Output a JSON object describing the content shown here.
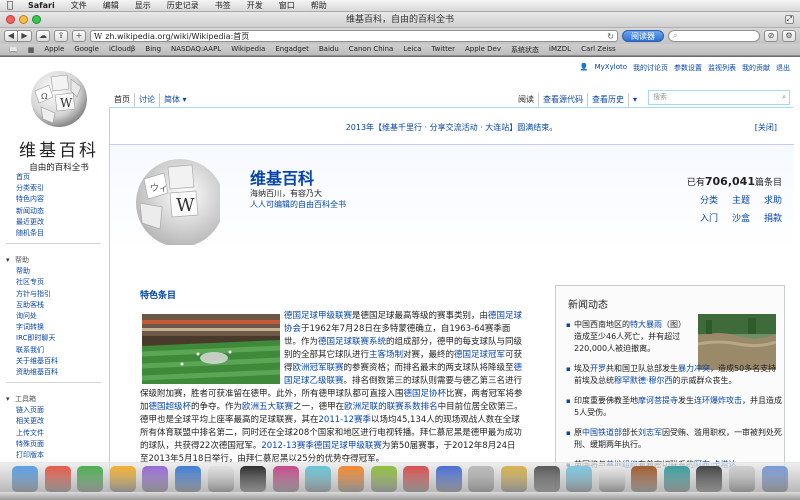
{
  "menubar": {
    "apple_icon": "",
    "items": [
      "Safari",
      "文件",
      "编辑",
      "显示",
      "历史记录",
      "书签",
      "开发",
      "窗口",
      "帮助"
    ]
  },
  "window": {
    "title": "维基百科，自由的百科全书"
  },
  "toolbar": {
    "back": "◀",
    "forward": "▶",
    "cloud": "☁",
    "share": "⇪",
    "add": "+",
    "url": "zh.wikipedia.org/wiki/Wikipedia:首页",
    "reload": "↻",
    "reader_label": "阅读器",
    "search_placeholder": "",
    "stop": "⊘",
    "extension": "⚙"
  },
  "bookmarks": [
    "Apple",
    "Google",
    "iCloudβ",
    "Bing",
    "NASDAQ:AAPL",
    "Wikipedia",
    "Engadget",
    "Baidu",
    "Canon China",
    "Leica",
    "Twitter",
    "Apple Dev",
    "系统状态",
    "iMZDL",
    "Carl Zeiss"
  ],
  "personal_tools": [
    "MyXyloto",
    "我的讨论页",
    "参数设置",
    "监视列表",
    "我的贡献",
    "退出"
  ],
  "logo": {
    "title": "维基百科",
    "subtitle": "自由的百科全书"
  },
  "tabs_left": [
    "首页",
    "讨论",
    "简体 ▾"
  ],
  "tabs_right": [
    "阅读",
    "查看源代码",
    "查看历史",
    "▾"
  ],
  "search_placeholder": "搜索",
  "notice": {
    "text": "2013年【维基千里行 · 分享交流活动 · 大连站】圆满结束。",
    "close": "[关闭]"
  },
  "banner": {
    "title": "维基百科",
    "tagline1": "海纳百川，有容乃大",
    "tagline2": "人人可编辑的自由百科全书",
    "count_prefix": "已有",
    "count": "706,041",
    "count_suffix": "篇条目",
    "portals": [
      "分类",
      "主题",
      "求助",
      "入门",
      "沙盒",
      "捐款"
    ]
  },
  "featured": {
    "heading": "特色条目",
    "text_html": [
      {
        "t": "德国足球甲级联赛",
        "l": true
      },
      {
        "t": "是德国足球最高等级的赛事类别，由",
        "l": false
      },
      {
        "t": "德国足球协会",
        "l": true
      },
      {
        "t": "于1962年7月28日在多特蒙德确立，自1963-64赛季面世。作为",
        "l": false
      },
      {
        "t": "德国足球联赛系统",
        "l": true
      },
      {
        "t": "的组成部分，德甲的每支球队与同级别的全部其它球队进行",
        "l": false
      },
      {
        "t": "主客场制",
        "l": true
      },
      {
        "t": "对赛，最终的",
        "l": false
      },
      {
        "t": "德国足球冠军",
        "l": true
      },
      {
        "t": "可获得",
        "l": false
      },
      {
        "t": "欧洲冠军联赛",
        "l": true
      },
      {
        "t": "的参赛资格；而排名最末的两支球队将降级至",
        "l": false
      },
      {
        "t": "德国足球乙级联赛",
        "l": true
      },
      {
        "t": "。排名倒数第三的球队则需要与德乙第三名进行保级附加赛，胜者可获准留在德甲。此外，所有德甲球队都可直接入围",
        "l": false
      },
      {
        "t": "德国足协杯",
        "l": true
      },
      {
        "t": "比赛，两者冠军将参加",
        "l": false
      },
      {
        "t": "德国超级杯",
        "l": true
      },
      {
        "t": "的争夺。作为",
        "l": false
      },
      {
        "t": "欧洲五大联赛",
        "l": true
      },
      {
        "t": "之一，德甲在",
        "l": false
      },
      {
        "t": "欧洲足联的联赛系数排名",
        "l": true
      },
      {
        "t": "中目前位居全欧第三。德甲也是全球平均上座率最高的足球联赛，其在",
        "l": false
      },
      {
        "t": "2011-12赛季",
        "l": true
      },
      {
        "t": "以场均45,134人的现场观战人数在全球所有体育联盟中排名第二，同时还在全球208个国家和地区进行电视转播。拜仁慕尼黑是德甲最为成功的球队，共获得22次德国冠军。",
        "l": false
      },
      {
        "t": "2012-13赛季德国足球甲级联赛",
        "l": true
      },
      {
        "t": "为第50届赛事，于2012年8月24日至2013年5月18日举行，由拜仁慕尼黑以25分的优势夺得冠军。",
        "l": false
      }
    ]
  },
  "news": {
    "heading": "新闻动态",
    "items": [
      [
        {
          "t": "中国西南地区的",
          "l": false
        },
        {
          "t": "特大暴雨",
          "l": true
        },
        {
          "t": "（图）造成至少46人死亡，并有超过220,000人被迫撤离。",
          "l": false
        }
      ],
      [
        {
          "t": "埃及",
          "l": false
        },
        {
          "t": "开罗",
          "l": true
        },
        {
          "t": "共和国卫队总部发生",
          "l": false
        },
        {
          "t": "暴力冲突",
          "l": true
        },
        {
          "t": "，造成50多名支持前埃及总统",
          "l": false
        },
        {
          "t": "穆罕默德·穆尔西",
          "l": true
        },
        {
          "t": "的示威群众丧生。",
          "l": false
        }
      ],
      [
        {
          "t": "印度重要佛教圣地",
          "l": false
        },
        {
          "t": "摩诃菩提寺",
          "l": true
        },
        {
          "t": "发生",
          "l": false
        },
        {
          "t": "连环爆炸攻击",
          "l": true
        },
        {
          "t": "，并且造成5人受伤。",
          "l": false
        }
      ],
      [
        {
          "t": "原",
          "l": false
        },
        {
          "t": "中国铁道部",
          "l": true
        },
        {
          "t": "部长",
          "l": false
        },
        {
          "t": "刘志军",
          "l": true
        },
        {
          "t": "因受贿、滥用职权，一审被判处死刑、缓期两年执行。",
          "l": false
        }
      ],
      [
        {
          "t": "英国将与",
          "l": false
        },
        {
          "t": "基地组织",
          "l": true
        },
        {
          "t": "有着密切联系的",
          "l": false
        },
        {
          "t": "阿布·卡塔达",
          "l": true
        }
      ]
    ]
  },
  "sidebar": {
    "main": [
      "首页",
      "分类索引",
      "特色内容",
      "新闻动态",
      "最近更改",
      "随机条目"
    ],
    "help_heading": "帮助",
    "help": [
      "帮助",
      "社区专页",
      "方针与指引",
      "互助客栈",
      "询问处",
      "字词转换",
      "IRC即时聊天",
      "联系我们",
      "关于维基百科",
      "资助维基百科"
    ],
    "tools_heading": "工具箱",
    "tools": [
      "链入页面",
      "相关更改",
      "上传文件",
      "特殊页面",
      "打印版本"
    ]
  },
  "colors": {
    "link": "#0645ad",
    "reader": "#2f6fd6",
    "frame": "#a7d7f9"
  }
}
